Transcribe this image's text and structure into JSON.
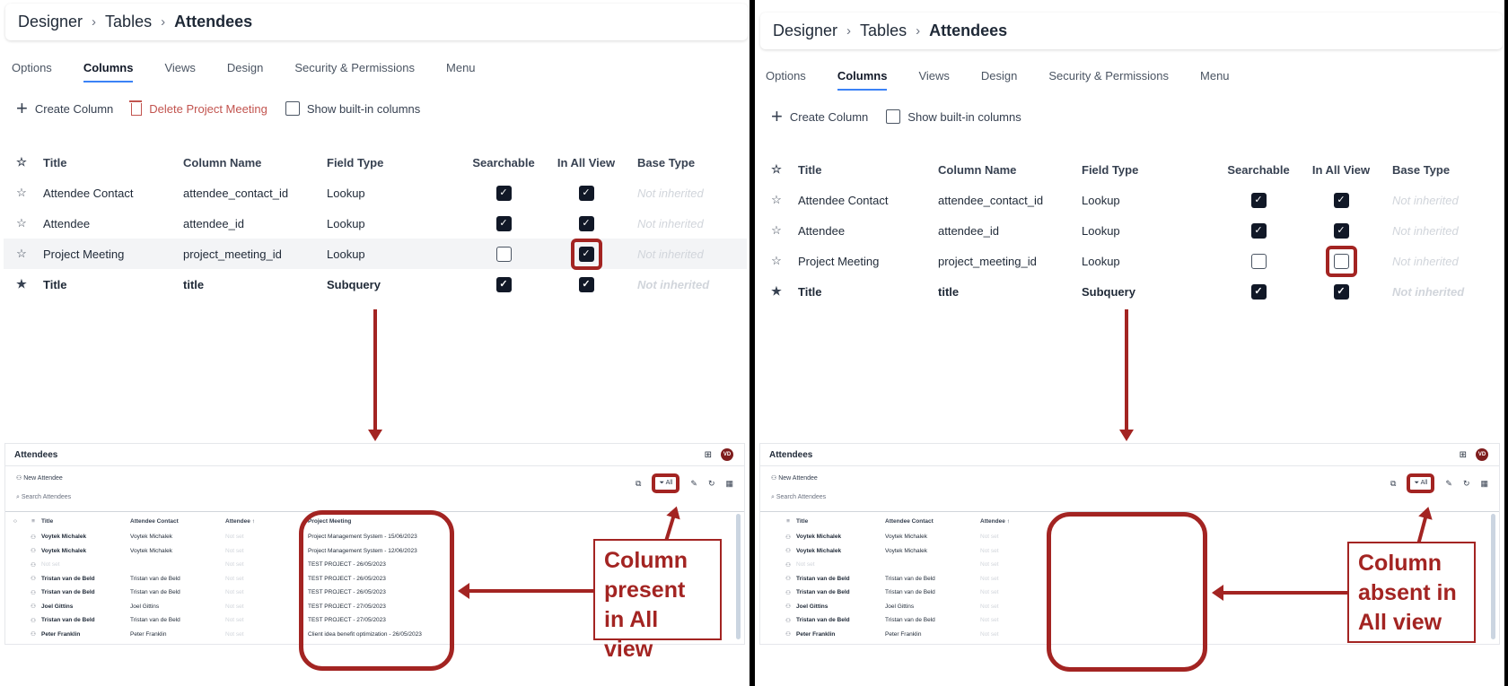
{
  "breadcrumb": {
    "root": "Designer",
    "mid": "Tables",
    "current": "Attendees",
    "sep": "›"
  },
  "tabs": [
    "Options",
    "Columns",
    "Views",
    "Design",
    "Security & Permissions",
    "Menu"
  ],
  "toolbar": {
    "create": "Create Column",
    "delete": "Delete Project Meeting",
    "builtin": "Show built-in columns"
  },
  "grid": {
    "headers": {
      "title": "Title",
      "column": "Column Name",
      "type": "Field Type",
      "searchable": "Searchable",
      "allview": "In All View",
      "base": "Base Type"
    },
    "rows": [
      {
        "title": "Attendee Contact",
        "column": "attendee_contact_id",
        "type": "Lookup",
        "base": "Not inherited"
      },
      {
        "title": "Attendee",
        "column": "attendee_id",
        "type": "Lookup",
        "base": "Not inherited"
      },
      {
        "title": "Project Meeting",
        "column": "project_meeting_id",
        "type": "Lookup",
        "base": "Not inherited"
      },
      {
        "title": "Title",
        "column": "title",
        "type": "Subquery",
        "base": "Not inherited"
      }
    ]
  },
  "app": {
    "title": "Attendees",
    "avatar": "VD",
    "new_label": "New Attendee",
    "search_placeholder": "Search Attendees",
    "filter_label": "All",
    "headers": {
      "title": "Title",
      "contact": "Attendee Contact",
      "attendee": "Attendee ↑",
      "project": "Project Meeting"
    },
    "rows": [
      {
        "title": "Voytek Michalek",
        "contact": "Voytek Michalek",
        "attendee": "Not set",
        "project": "Project Management System - 15/06/2023"
      },
      {
        "title": "Voytek Michalek",
        "contact": "Voytek Michalek",
        "attendee": "Not set",
        "project": "Project Management System - 12/06/2023"
      },
      {
        "title": "Not set",
        "contact": "",
        "attendee": "Not set",
        "project": "TEST PROJECT - 26/05/2023"
      },
      {
        "title": "Tristan van de Beld",
        "contact": "Tristan van de Beld",
        "attendee": "Not set",
        "project": "TEST PROJECT - 26/05/2023"
      },
      {
        "title": "Tristan van de Beld",
        "contact": "Tristan van de Beld",
        "attendee": "Not set",
        "project": "TEST PROJECT - 26/05/2023"
      },
      {
        "title": "Joel Gittins",
        "contact": "Joel Gittins",
        "attendee": "Not set",
        "project": "TEST PROJECT - 27/05/2023"
      },
      {
        "title": "Tristan van de Beld",
        "contact": "Tristan van de Beld",
        "attendee": "Not set",
        "project": "TEST PROJECT - 27/05/2023"
      },
      {
        "title": "Peter Franklin",
        "contact": "Peter Franklin",
        "attendee": "Not set",
        "project": "Client idea benefit optimization - 26/05/2023"
      }
    ]
  },
  "callouts": {
    "left": "Column present in All view",
    "right": "Column absent in All view"
  },
  "colors": {
    "accent": "#a32422",
    "checkbox": "#111827"
  }
}
